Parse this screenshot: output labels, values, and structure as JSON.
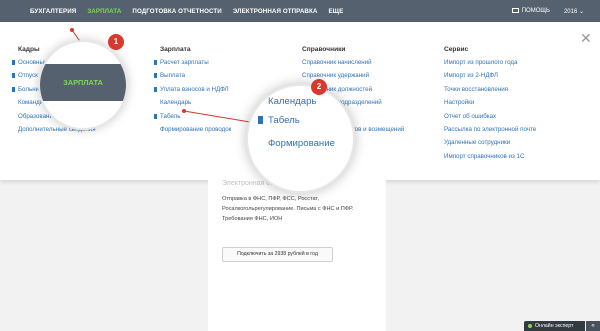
{
  "nav": {
    "items": [
      "БУХГАЛТЕРИЯ",
      "ЗАРПЛАТА",
      "ПОДГОТОВКА ОТЧЕТНОСТИ",
      "ЭЛЕКТРОННАЯ ОТПРАВКА",
      "ЕЩЕ"
    ],
    "help": "ПОМОЩЬ",
    "year": "2016"
  },
  "columns": [
    {
      "title": "Кадры",
      "items": [
        "Основные",
        "Отпуск",
        "Больничные",
        "Командировки",
        "Образование",
        "Дополнительные сведения"
      ]
    },
    {
      "title": "Зарплата",
      "items": [
        "Расчет зарплаты",
        "Выплата",
        "Уплата взносов и НДФЛ",
        "Календарь",
        "Табель",
        "Формирование проводок"
      ]
    },
    {
      "title": "Справочники",
      "items": [
        "Справочник начислений",
        "Справочник удержаний",
        "Справочник должностей",
        "Справочник подразделений",
        "",
        "Справочник вычетов и возмещений"
      ]
    },
    {
      "title": "Сервис",
      "items": [
        "Импорт из прошлого года",
        "Импорт из 2-НДФЛ",
        "Точки восстановления",
        "Настройки",
        "Отчет об ошибках",
        "Рассылка по электронной почте",
        "Удаленные сотрудники",
        "Импорт справочников из 1С"
      ]
    }
  ],
  "zoom1": {
    "badge": "1",
    "label": "ЗАРПЛАТА"
  },
  "zoom2": {
    "badge": "2",
    "items": [
      "Календарь",
      "Табель",
      "Формирование"
    ]
  },
  "promo": {
    "heading": "Электронная отправка",
    "lines": [
      "Отправка в ФНС, ПФР, ФСС, Росстат,",
      "Росалкогольрегулирование. Письма с ФНС и ПФР.",
      "Требования ФНС, ИОН"
    ],
    "button": "Подключить за 2938 рублей в год"
  },
  "chat": {
    "label": "Онлайн эксперт",
    "collapse": "«"
  },
  "colors": {
    "topbar": "#55616f",
    "active": "#7ed957",
    "link": "#2f73b5",
    "badge": "#d9392c"
  }
}
